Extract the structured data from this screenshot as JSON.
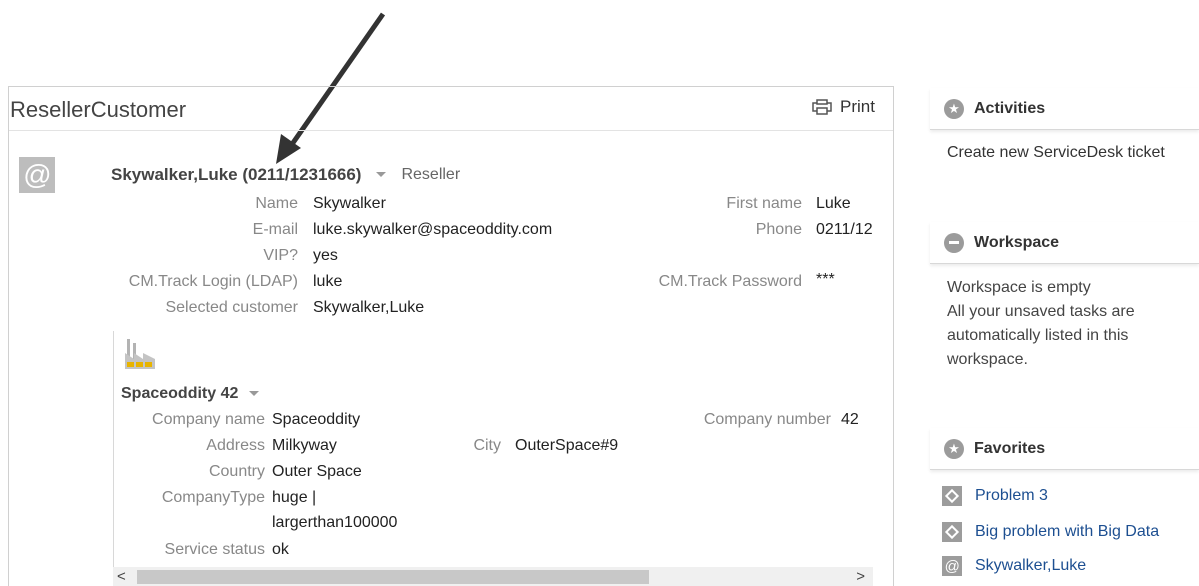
{
  "panel": {
    "title": "ResellerCustomer",
    "print_label": "Print"
  },
  "customer": {
    "header_name": "Skywalker,Luke (0211/1231666)",
    "header_type": "Reseller",
    "fields": {
      "name_label": "Name",
      "name_value": "Skywalker",
      "email_label": "E-mail",
      "email_value": "luke.skywalker@spaceoddity.com",
      "vip_label": "VIP?",
      "vip_value": "yes",
      "login_label": "CM.Track Login (LDAP)",
      "login_value": "luke",
      "selected_label": "Selected customer",
      "selected_value": "Skywalker,Luke",
      "firstname_label": "First name",
      "firstname_value": "Luke",
      "phone_label": "Phone",
      "phone_value": "0211/12",
      "password_label": "CM.Track Password",
      "password_value": "***"
    }
  },
  "company": {
    "header": "Spaceoddity 42",
    "fields": {
      "company_name_label": "Company name",
      "company_name_value": "Spaceoddity",
      "address_label": "Address",
      "address_value": "Milkyway",
      "city_label": "City",
      "city_value": "OuterSpace#9",
      "country_label": "Country",
      "country_value": "Outer Space",
      "type_label": "CompanyType",
      "type_value_line1": "huge |",
      "type_value_line2": "largerthan100000",
      "service_label": "Service status",
      "service_value": "ok",
      "number_label": "Company number",
      "number_value": "42"
    }
  },
  "scrollbar": {
    "left_arrow": "<",
    "right_arrow": ">"
  },
  "sidebar": {
    "activities": {
      "title": "Activities",
      "item": "Create new ServiceDesk ticket"
    },
    "workspace": {
      "title": "Workspace",
      "line1": "Workspace is empty",
      "line2": "All your unsaved tasks are",
      "line3": "automatically listed in this",
      "line4": "workspace."
    },
    "favorites": {
      "title": "Favorites",
      "items": [
        "Problem 3",
        "Big problem with Big Data",
        "Skywalker,Luke"
      ]
    }
  },
  "colors": {
    "link": "#1d4f91",
    "label_grey": "#888888",
    "icon_grey": "#9b9b9b"
  }
}
